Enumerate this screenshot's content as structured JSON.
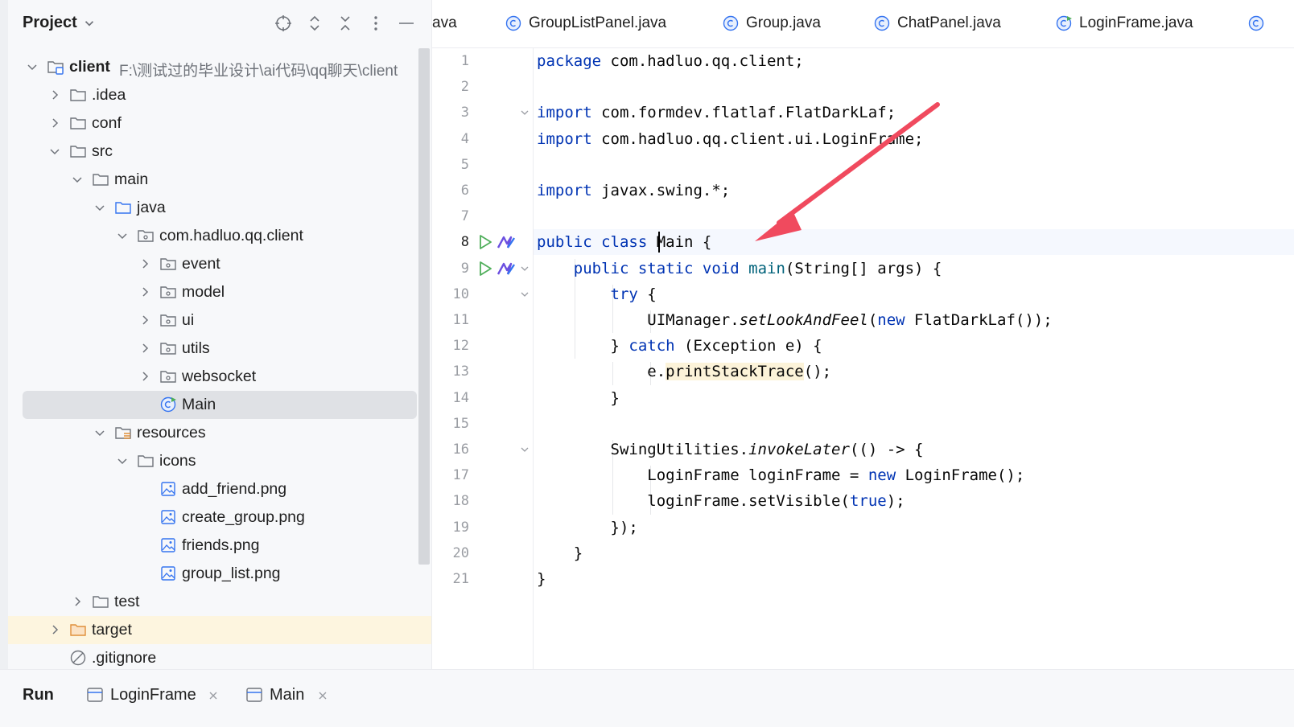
{
  "project": {
    "title": "Project",
    "header_icons": [
      "crosshair-icon",
      "expand-icon",
      "collapse-icon",
      "more-icon",
      "minimize-icon"
    ],
    "root_name": "client",
    "root_path": "F:\\测试过的毕业设计\\ai代码\\qq聊天\\client",
    "tree": [
      {
        "label": ".idea",
        "type": "folder",
        "depth": 1,
        "expanded": false
      },
      {
        "label": "conf",
        "type": "folder",
        "depth": 1,
        "expanded": false
      },
      {
        "label": "src",
        "type": "folder",
        "depth": 1,
        "expanded": true
      },
      {
        "label": "main",
        "type": "folder",
        "depth": 2,
        "expanded": true
      },
      {
        "label": "java",
        "type": "source-folder",
        "depth": 3,
        "expanded": true
      },
      {
        "label": "com.hadluo.qq.client",
        "type": "package",
        "depth": 4,
        "expanded": true
      },
      {
        "label": "event",
        "type": "package",
        "depth": 5,
        "expanded": false
      },
      {
        "label": "model",
        "type": "package",
        "depth": 5,
        "expanded": false
      },
      {
        "label": "ui",
        "type": "package",
        "depth": 5,
        "expanded": false
      },
      {
        "label": "utils",
        "type": "package",
        "depth": 5,
        "expanded": false
      },
      {
        "label": "websocket",
        "type": "package",
        "depth": 5,
        "expanded": false
      },
      {
        "label": "Main",
        "type": "class",
        "depth": 5,
        "selected": true
      },
      {
        "label": "resources",
        "type": "resources-folder",
        "depth": 3,
        "expanded": true
      },
      {
        "label": "icons",
        "type": "folder",
        "depth": 4,
        "expanded": true
      },
      {
        "label": "add_friend.png",
        "type": "image",
        "depth": 5
      },
      {
        "label": "create_group.png",
        "type": "image",
        "depth": 5
      },
      {
        "label": "friends.png",
        "type": "image",
        "depth": 5
      },
      {
        "label": "group_list.png",
        "type": "image",
        "depth": 5
      },
      {
        "label": "test",
        "type": "folder",
        "depth": 2,
        "expanded": false
      },
      {
        "label": "target",
        "type": "excluded-folder",
        "depth": 1,
        "expanded": false,
        "highlight": true
      },
      {
        "label": ".gitignore",
        "type": "ignored-file",
        "depth": 1
      }
    ]
  },
  "editor": {
    "tabs": [
      {
        "label": "ava",
        "icon": "none"
      },
      {
        "label": "GroupListPanel.java",
        "icon": "class-icon"
      },
      {
        "label": "Group.java",
        "icon": "class-icon"
      },
      {
        "label": "ChatPanel.java",
        "icon": "class-icon"
      },
      {
        "label": "LoginFrame.java",
        "icon": "runnable-class-icon"
      },
      {
        "label": "",
        "icon": "class-icon"
      }
    ],
    "current_line": 8,
    "line_numbers": [
      "1",
      "2",
      "3",
      "4",
      "5",
      "6",
      "7",
      "8",
      "9",
      "10",
      "11",
      "12",
      "13",
      "14",
      "15",
      "16",
      "17",
      "18",
      "19",
      "20",
      "21"
    ],
    "lines": [
      [
        {
          "t": "package",
          "c": "kw"
        },
        {
          "t": " com.hadluo.qq.client;"
        }
      ],
      [],
      [
        {
          "t": "import",
          "c": "kw"
        },
        {
          "t": " com.formdev.flatlaf.FlatDarkLaf;"
        }
      ],
      [
        {
          "t": "import",
          "c": "kw"
        },
        {
          "t": " com.hadluo.qq.client.ui.LoginFrame;"
        }
      ],
      [],
      [
        {
          "t": "import",
          "c": "kw"
        },
        {
          "t": " javax.swing.*;"
        }
      ],
      [],
      [
        {
          "t": "public class",
          "c": "kw"
        },
        {
          "t": " Main {"
        }
      ],
      [
        {
          "t": "    "
        },
        {
          "t": "public static void",
          "c": "kw"
        },
        {
          "t": " "
        },
        {
          "t": "main",
          "c": "fn"
        },
        {
          "t": "(String[] args) {"
        }
      ],
      [
        {
          "t": "        "
        },
        {
          "t": "try",
          "c": "kw"
        },
        {
          "t": " {"
        }
      ],
      [
        {
          "t": "            UIManager."
        },
        {
          "t": "setLookAndFeel",
          "c": "it"
        },
        {
          "t": "("
        },
        {
          "t": "new",
          "c": "kw"
        },
        {
          "t": " FlatDarkLaf());"
        }
      ],
      [
        {
          "t": "        } "
        },
        {
          "t": "catch",
          "c": "kw"
        },
        {
          "t": " (Exception e) {"
        }
      ],
      [
        {
          "t": "            e."
        },
        {
          "t": "printStackTrace",
          "c": "hl"
        },
        {
          "t": "();"
        }
      ],
      [
        {
          "t": "        }"
        }
      ],
      [],
      [
        {
          "t": "        SwingUtilities."
        },
        {
          "t": "invokeLater",
          "c": "it"
        },
        {
          "t": "(() -> {"
        }
      ],
      [
        {
          "t": "            LoginFrame loginFrame = "
        },
        {
          "t": "new",
          "c": "kw"
        },
        {
          "t": " LoginFrame();"
        }
      ],
      [
        {
          "t": "            loginFrame.setVisible("
        },
        {
          "t": "true",
          "c": "kw"
        },
        {
          "t": ");"
        }
      ],
      [
        {
          "t": "        });"
        }
      ],
      [
        {
          "t": "    }"
        }
      ],
      [
        {
          "t": "}"
        }
      ]
    ]
  },
  "run": {
    "title": "Run",
    "tabs": [
      {
        "label": "LoginFrame"
      },
      {
        "label": "Main"
      }
    ]
  },
  "colors": {
    "keyword": "#0033b3",
    "method": "#00627a",
    "arrow": "#f04a5e",
    "accent": "#3574f0"
  }
}
